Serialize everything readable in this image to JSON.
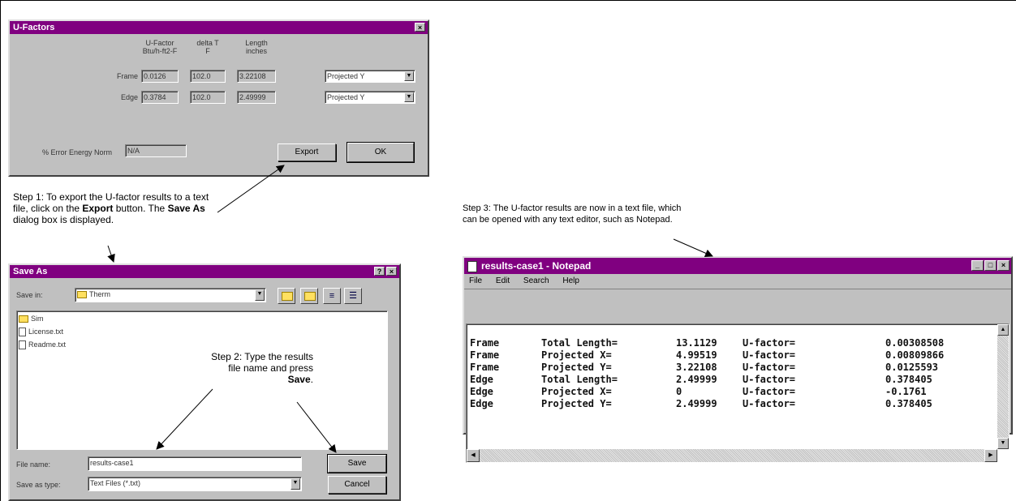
{
  "ufactors_dialog": {
    "title": "U-Factors",
    "col_ufactor": "U-Factor",
    "col_ufactor_unit": "Btu/h-ft2-F",
    "col_deltat": "delta T",
    "col_deltat_unit": "F",
    "col_length": "Length",
    "col_length_unit": "inches",
    "rows": [
      {
        "label": "Frame",
        "ufactor": "0.0126",
        "deltat": "102.0",
        "length": "3.22108",
        "proj": "Projected Y"
      },
      {
        "label": "Edge",
        "ufactor": "0.3784",
        "deltat": "102.0",
        "length": "2.49999",
        "proj": "Projected Y"
      }
    ],
    "error_label": "% Error Energy Norm",
    "error_value": "N/A",
    "export_label": "Export",
    "ok_label": "OK"
  },
  "step1": {
    "pre": "Step 1: To export the U-factor results to a text file, click on the ",
    "b1": "Export",
    "mid": " button. The ",
    "b2": "Save As",
    "post": " dialog box is displayed."
  },
  "saveas_dialog": {
    "title": "Save As",
    "save_in_label": "Save in:",
    "save_in_value": "Therm",
    "files": [
      {
        "name": "Sim",
        "type": "folder"
      },
      {
        "name": "License.txt",
        "type": "file"
      },
      {
        "name": "Readme.txt",
        "type": "file"
      }
    ],
    "filename_label": "File name:",
    "filename_value": "results-case1",
    "savetype_label": "Save as type:",
    "savetype_value": "Text Files (*.txt)",
    "save_label": "Save",
    "cancel_label": "Cancel"
  },
  "step2": {
    "pre": "Step 2: Type the results file name and press ",
    "b": "Save",
    "post": "."
  },
  "step3": {
    "text": "Step 3: The U-factor results are now in a text file, which can be opened with any text editor, such as Notepad."
  },
  "notepad": {
    "title": "results-case1 - Notepad",
    "menu": [
      "File",
      "Edit",
      "Search",
      "Help"
    ],
    "lines": [
      {
        "c1": "Frame",
        "c2": "Total Length=",
        "c3": "13.1129",
        "c4": "U-factor=",
        "c5": "0.00308508"
      },
      {
        "c1": "Frame",
        "c2": "Projected X=",
        "c3": "4.99519",
        "c4": "U-factor=",
        "c5": "0.00809866"
      },
      {
        "c1": "Frame",
        "c2": "Projected Y=",
        "c3": "3.22108",
        "c4": "U-factor=",
        "c5": "0.0125593"
      },
      {
        "c1": "Edge",
        "c2": "Total Length=",
        "c3": "2.49999",
        "c4": "U-factor=",
        "c5": "0.378405"
      },
      {
        "c1": "Edge",
        "c2": "Projected X=",
        "c3": "0",
        "c4": "U-factor=",
        "c5": "-0.1761"
      },
      {
        "c1": "Edge",
        "c2": "Projected Y=",
        "c3": "2.49999",
        "c4": "U-factor=",
        "c5": "0.378405"
      }
    ]
  },
  "colors": {
    "titlebar": "#800080",
    "face": "#c0c0c0"
  }
}
